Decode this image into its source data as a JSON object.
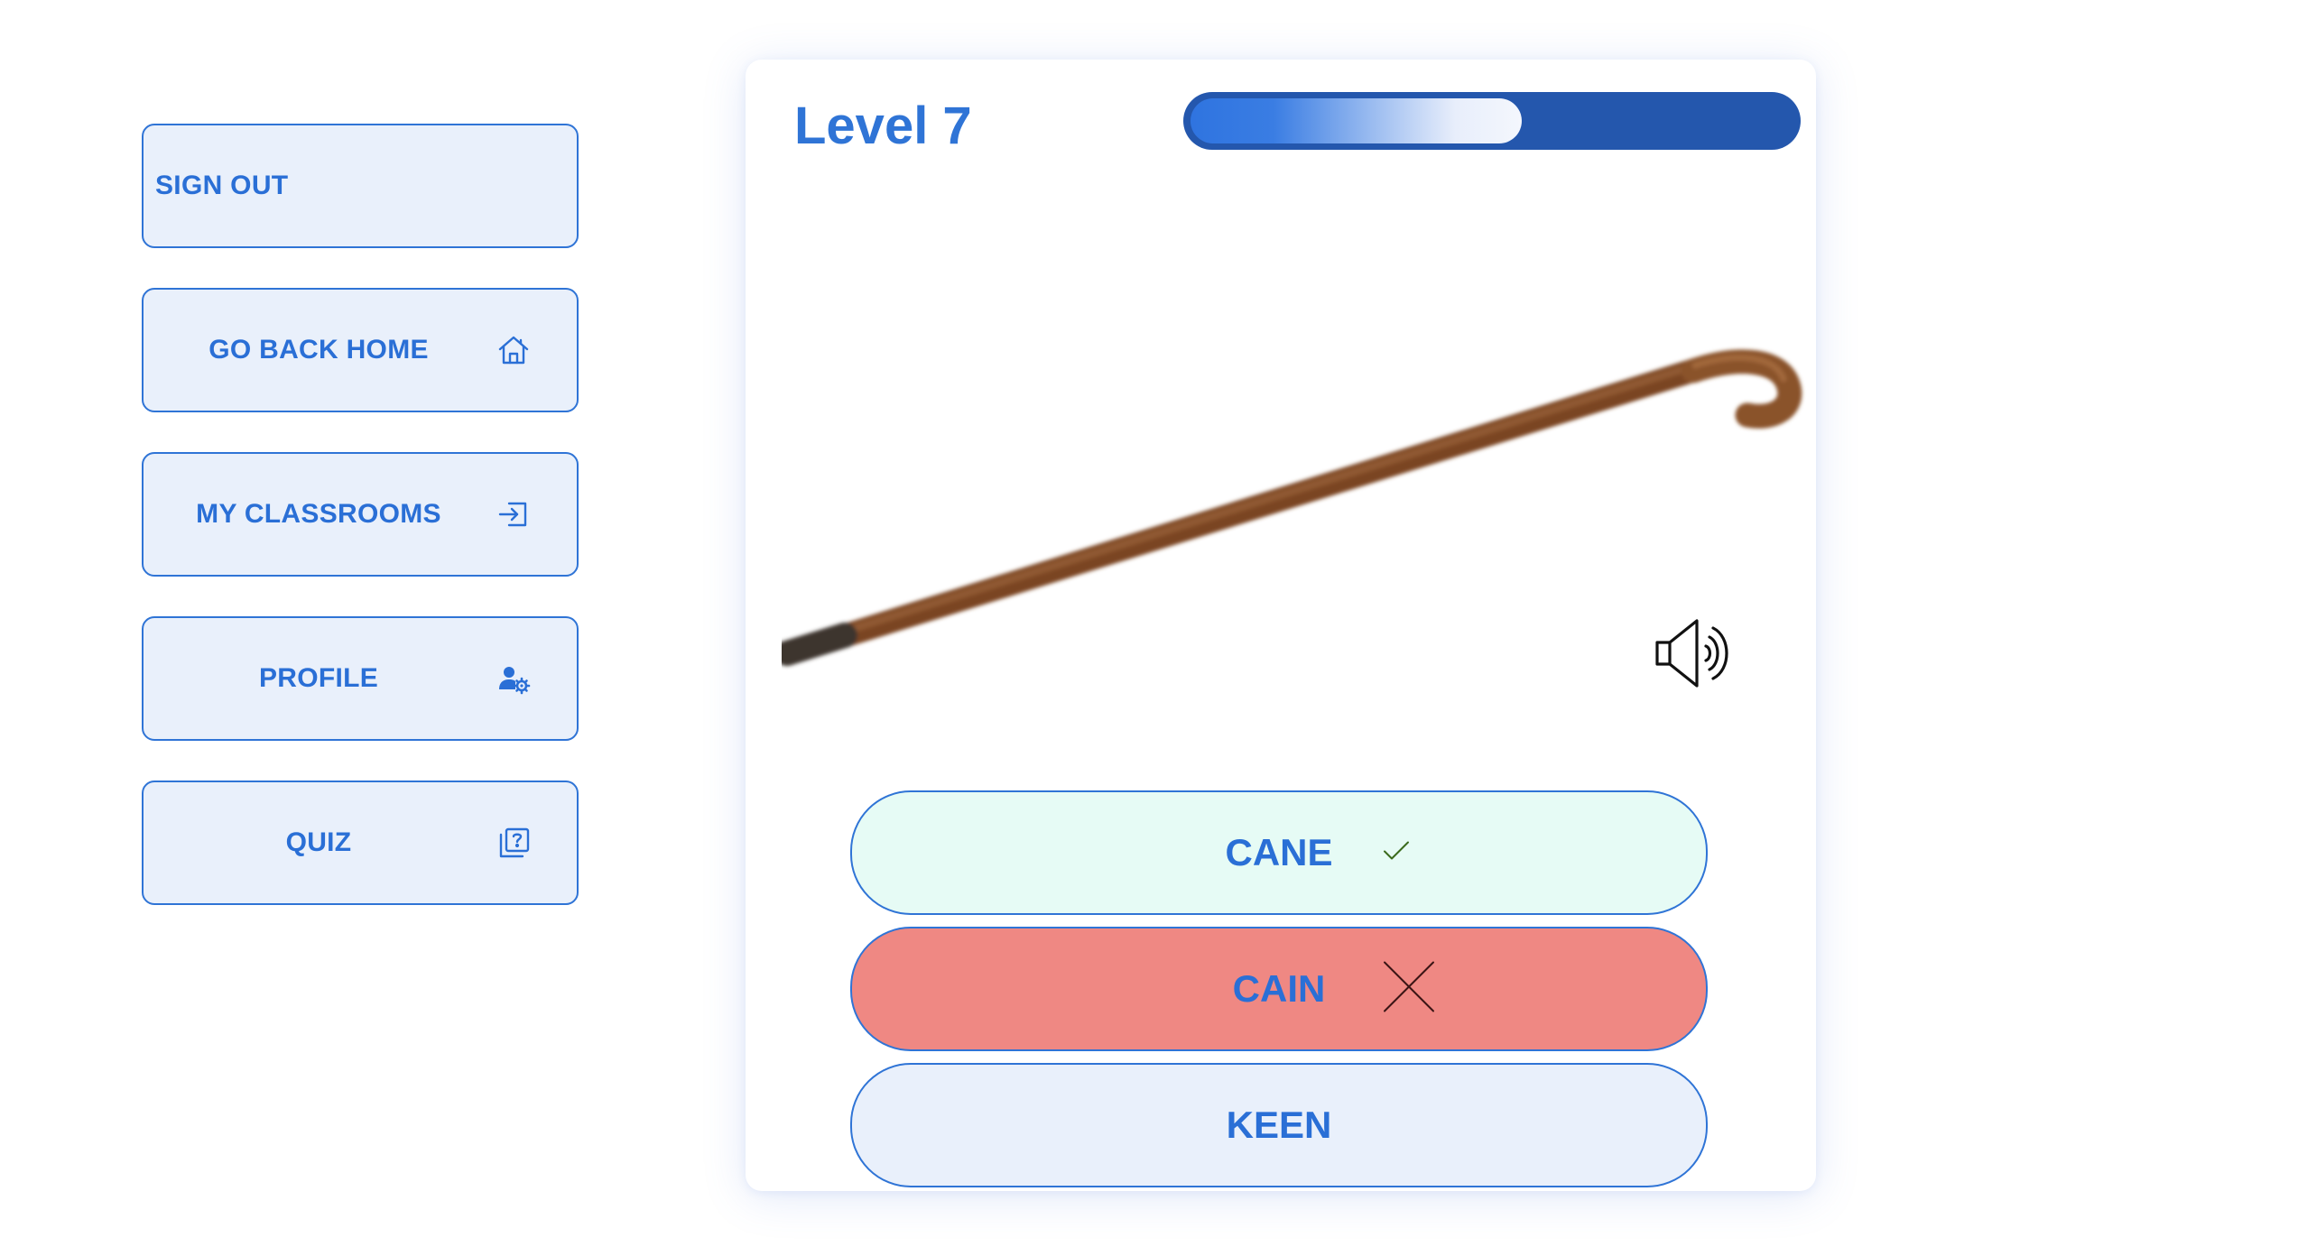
{
  "sidebar": {
    "items": [
      {
        "label": "SIGN OUT",
        "icon": "none"
      },
      {
        "label": "GO BACK HOME",
        "icon": "home-icon"
      },
      {
        "label": "MY CLASSROOMS",
        "icon": "enter-icon"
      },
      {
        "label": "PROFILE",
        "icon": "user-settings-icon"
      },
      {
        "label": "QUIZ",
        "icon": "quiz-question-icon"
      }
    ]
  },
  "quiz": {
    "level": "Level 7",
    "progress": 0.55,
    "image": "walking-cane-image",
    "speaker": "speaker-sound-icon",
    "answers": [
      {
        "label": "CANE",
        "state": "correct",
        "mark": "check-icon"
      },
      {
        "label": "CAIN",
        "state": "wrong",
        "mark": "cross-icon"
      },
      {
        "label": "KEEN",
        "state": "neutral",
        "mark": ""
      }
    ]
  },
  "colors": {
    "accent": "#2f74d6",
    "sidebar_bg": "#e9f0fb",
    "progress_track": "#2457ad",
    "correct_bg": "#e6fbf5",
    "wrong_bg": "#ef8883",
    "neutral_bg": "#e9f0fb",
    "cane": "#8b5530"
  }
}
